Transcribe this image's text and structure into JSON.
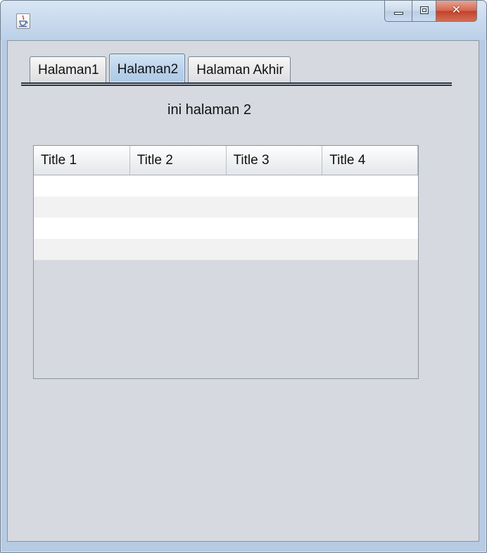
{
  "window": {
    "title": ""
  },
  "tabs": [
    {
      "label": "Halaman1",
      "active": false
    },
    {
      "label": "Halaman2",
      "active": true
    },
    {
      "label": "Halaman Akhir",
      "active": false
    }
  ],
  "page": {
    "label": "ini halaman 2"
  },
  "table": {
    "columns": [
      "Title 1",
      "Title 2",
      "Title 3",
      "Title 4"
    ],
    "row_count": 4
  },
  "icons": {
    "app": "java-coffee-cup-icon",
    "minimize": "minimize-icon",
    "maximize": "maximize-icon",
    "close": "close-icon"
  },
  "colors": {
    "client_bg": "#d6d9df",
    "close_button": "#c2412a",
    "active_tab": "#b7d0ea"
  }
}
